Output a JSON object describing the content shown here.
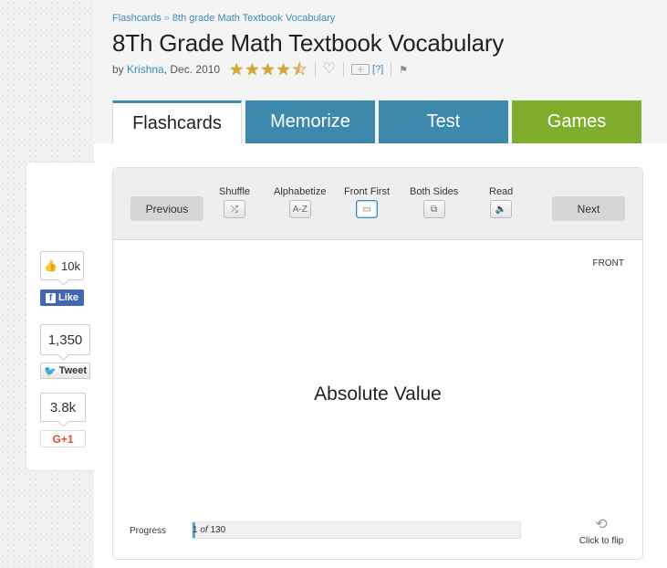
{
  "breadcrumb": {
    "root": "Flashcards",
    "separator": "»",
    "current": "8th grade Math Textbook Vocabulary"
  },
  "title": "8Th Grade Math Textbook Vocabulary",
  "byline": {
    "prefix": "by",
    "author": "Krishna",
    "date": ", Dec. 2010",
    "rating_stars": 4.5,
    "help_link": "[?]"
  },
  "tabs": [
    "Flashcards",
    "Memorize",
    "Test",
    "Games"
  ],
  "social": {
    "facebook_count": "10k",
    "facebook_label": "Like",
    "tweet_count": "1,350",
    "tweet_label": "Tweet",
    "gplus_count": "3.8k",
    "gplus_label": "G+1"
  },
  "toolbar": {
    "previous": "Previous",
    "next": "Next",
    "tools": [
      {
        "label": "Shuffle",
        "icon": "shuffle-icon",
        "glyph": "⤮"
      },
      {
        "label": "Alphabetize",
        "icon": "alphabetize-icon",
        "glyph": "A-Z"
      },
      {
        "label": "Front First",
        "icon": "front-first-icon",
        "glyph": "▭"
      },
      {
        "label": "Both Sides",
        "icon": "both-sides-icon",
        "glyph": "⧉"
      },
      {
        "label": "Read",
        "icon": "speaker-icon",
        "glyph": "🔈"
      }
    ]
  },
  "card": {
    "side": "FRONT",
    "term": "Absolute Value"
  },
  "progress": {
    "label": "Progress",
    "current": "1",
    "of": "of",
    "total": "130",
    "fraction": 0.0077
  },
  "flip": {
    "label": "Click to flip"
  },
  "colors": {
    "accent": "#3d89ad",
    "games": "#7fae2c",
    "link": "#3b8cb3"
  }
}
